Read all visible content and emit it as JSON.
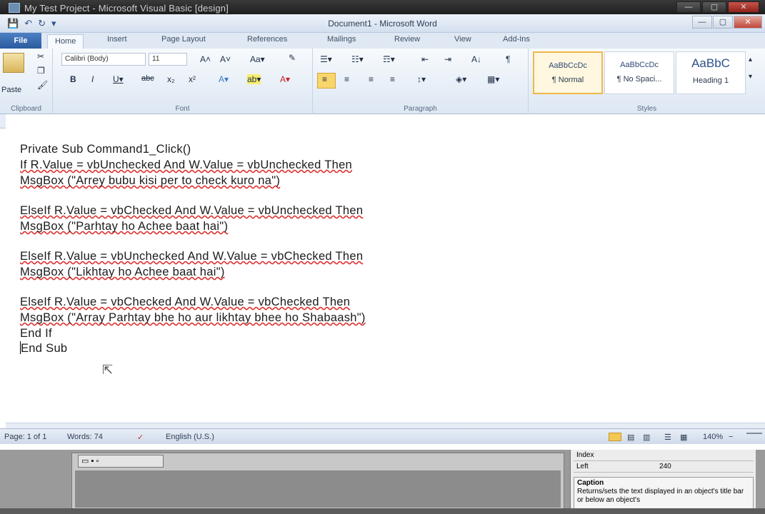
{
  "outer_window": {
    "title": "My Test Project - Microsoft Visual Basic [design]",
    "min": "—",
    "max": "▢",
    "close": "✕"
  },
  "word": {
    "caption": "Document1 - Microsoft Word",
    "qat": {
      "save": "💾",
      "undo": "↶",
      "redo": "↻",
      "more": "▾"
    },
    "controls": {
      "min": "—",
      "max": "▢",
      "close": "✕"
    },
    "tabs": {
      "file": "File",
      "home": "Home",
      "insert": "Insert",
      "page_layout": "Page Layout",
      "references": "References",
      "mailings": "Mailings",
      "review": "Review",
      "view": "View",
      "addins": "Add-Ins"
    },
    "ribbon": {
      "clipboard": {
        "paste": "Paste",
        "label": "Clipboard"
      },
      "font": {
        "font_name": "Calibri (Body)",
        "font_size": "11",
        "grow": "A˄",
        "shrink": "A˅",
        "change_case": "Aa▾",
        "clear": "✎",
        "bold": "B",
        "italic": "I",
        "underline": "U▾",
        "strike": "abc",
        "subscript": "x₂",
        "superscript": "x²",
        "effects": "A▾",
        "highlight": "ab▾",
        "font_color": "A▾",
        "label": "Font"
      },
      "paragraph": {
        "bullets": "☰▾",
        "numbering": "☷▾",
        "multilevel": "☶▾",
        "dec_indent": "⇤",
        "inc_indent": "⇥",
        "sort": "A↓",
        "show_marks": "¶",
        "align_left": "≡",
        "align_center": "≡",
        "align_right": "≡",
        "justify": "≡",
        "line_spacing": "↕▾",
        "shading": "◈▾",
        "borders": "▦▾",
        "label": "Paragraph"
      },
      "styles": {
        "items": [
          {
            "preview": "AaBbCcDc",
            "name": "¶ Normal"
          },
          {
            "preview": "AaBbCcDc",
            "name": "¶ No Spaci..."
          },
          {
            "preview": "AaBbC",
            "name": "Heading 1"
          }
        ],
        "label": "Styles"
      }
    },
    "document": {
      "lines": [
        "Private Sub Command1_Click()",
        "If R.Value = vbUnchecked And W.Value = vbUnchecked Then",
        "MsgBox (\"Arrey bubu kisi per to check kuro na\")",
        "ElseIf R.Value = vbChecked And W.Value = vbUnchecked Then",
        "MsgBox (\"Parhtay ho Achee baat hai\")",
        "ElseIf R.Value = vbUnchecked And W.Value = vbChecked Then",
        "MsgBox (\"Likhtay ho Achee baat hai\")",
        "ElseIf R.Value = vbChecked And W.Value = vbChecked Then",
        "MsgBox (\"Array Parhtay bhe ho aur likhtay bhee ho Shabaash\")",
        "End If",
        "End Sub"
      ]
    },
    "status": {
      "page": "Page: 1 of 1",
      "words": "Words: 74",
      "proof_icon": "✓",
      "language": "English (U.S.)",
      "zoom": "140%",
      "zoom_out": "−",
      "zoom_in": "+"
    }
  },
  "vb_ide": {
    "form_control": "▭ ▪ ▫",
    "properties": {
      "rows": [
        {
          "name": "Index",
          "value": ""
        },
        {
          "name": "Left",
          "value": "240"
        }
      ],
      "help_title": "Caption",
      "help_text": "Returns/sets the text displayed in an object's title bar or below an object's"
    }
  }
}
